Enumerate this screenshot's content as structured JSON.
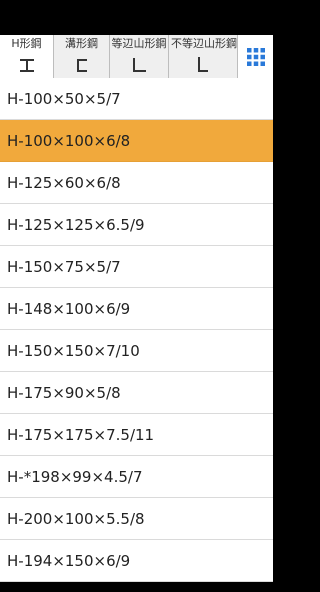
{
  "tabs": [
    {
      "label": "H形鋼",
      "icon": "h-beam-icon",
      "selected": true
    },
    {
      "label": "溝形鋼",
      "icon": "channel-icon",
      "selected": false
    },
    {
      "label": "等辺山形鋼",
      "icon": "equal-angle-icon",
      "selected": false
    },
    {
      "label": "不等辺山形鋼",
      "icon": "unequal-angle-icon",
      "selected": false
    }
  ],
  "menu_icon": "grid-menu-icon",
  "colors": {
    "accent": "#2979d9",
    "selected_row": "#f1a93c",
    "tabbar_bg": "#eeeeee"
  },
  "rows": [
    "H-100×50×5/7",
    "H-100×100×6/8",
    "H-125×60×6/8",
    "H-125×125×6.5/9",
    "H-150×75×5/7",
    "H-148×100×6/9",
    "H-150×150×7/10",
    "H-175×90×5/8",
    "H-175×175×7.5/11",
    "H-*198×99×4.5/7",
    "H-200×100×5.5/8",
    "H-194×150×6/9"
  ],
  "selected_row_index": 1
}
